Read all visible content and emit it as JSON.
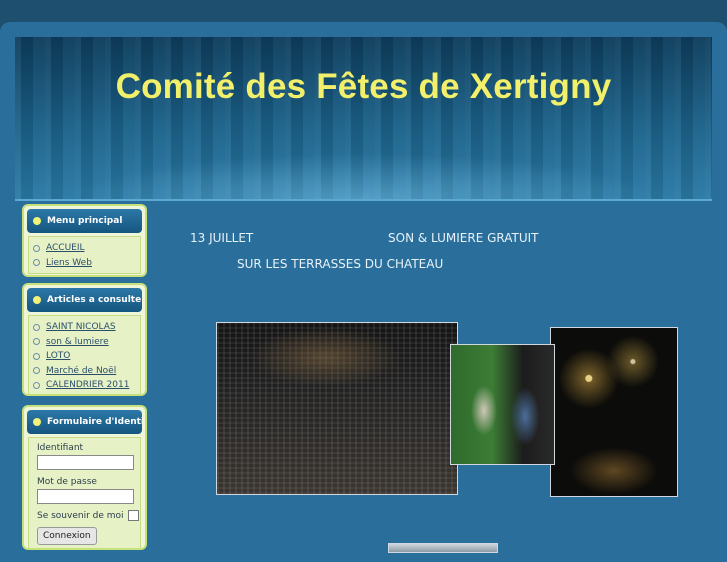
{
  "header": {
    "title": "Comité des Fêtes de Xertigny"
  },
  "menu_principal": {
    "title": "Menu principal",
    "items": [
      {
        "label": "ACCUEIL"
      },
      {
        "label": "Liens Web"
      }
    ]
  },
  "articles": {
    "title": "Articles a consulter",
    "items": [
      {
        "label": "SAINT NICOLAS"
      },
      {
        "label": "son & lumiere"
      },
      {
        "label": "LOTO"
      },
      {
        "label": "Marché de Noël"
      },
      {
        "label": "CALENDRIER 2011"
      }
    ]
  },
  "login": {
    "title": "Formulaire d'Identification",
    "username_label": "Identifiant",
    "username_value": "",
    "password_label": "Mot de passe",
    "password_value": "",
    "remember_label": "Se souvenir de moi",
    "submit_label": "Connexion"
  },
  "content": {
    "date": "13 JUILLET",
    "event": "SON & LUMIERE GRATUIT",
    "location": "SUR LES TERRASSES DU CHATEAU"
  },
  "colors": {
    "title_yellow": "#f2f06a",
    "page_blue": "#2a6f9c",
    "module_green": "#eef5d9"
  }
}
